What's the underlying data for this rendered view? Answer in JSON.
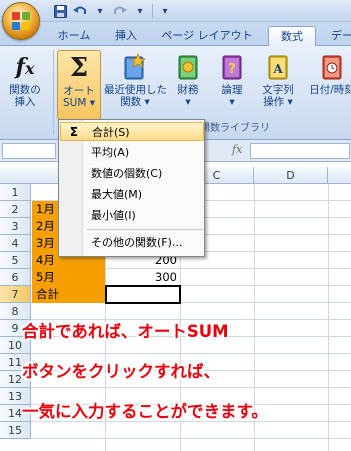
{
  "qat": {
    "save_icon": "save-icon",
    "undo_icon": "undo-icon",
    "redo_icon": "redo-icon",
    "customize_icon": "customize-icon"
  },
  "tabs": [
    {
      "label": "ホーム"
    },
    {
      "label": "挿入"
    },
    {
      "label": "ページ レイアウト"
    },
    {
      "label": "数式",
      "active": true
    },
    {
      "label": "デー"
    }
  ],
  "ribbon": {
    "buttons": [
      {
        "label1": "関数の",
        "label2": "挿入",
        "icon": "fx-icon"
      },
      {
        "label1": "オート",
        "label2": "SUM ▾",
        "icon": "sigma-icon",
        "pressed": true
      },
      {
        "label1": "最近使用した",
        "label2": "関数 ▾",
        "icon": "star-book-icon"
      },
      {
        "label1": "財務",
        "label2": "▾",
        "icon": "finance-book-icon"
      },
      {
        "label1": "論理",
        "label2": "▾",
        "icon": "logic-book-icon"
      },
      {
        "label1": "文字列",
        "label2": "操作 ▾",
        "icon": "text-book-icon"
      },
      {
        "label1": "日付/時刻",
        "label2": "",
        "icon": "date-book-icon"
      }
    ],
    "group_label": "関数ライブラリ"
  },
  "formula_bar": {
    "fx_label": "fx"
  },
  "menu": {
    "items": [
      {
        "icon": "Σ",
        "label": "合計(S)",
        "highlight": true
      },
      {
        "icon": "",
        "label": "平均(A)"
      },
      {
        "icon": "",
        "label": "数値の個数(C)"
      },
      {
        "icon": "",
        "label": "最大値(M)"
      },
      {
        "icon": "",
        "label": "最小値(I)"
      },
      {
        "icon": "",
        "label": "その他の関数(F)..."
      }
    ]
  },
  "sheet": {
    "columns": [
      "C",
      "D"
    ],
    "rows": [
      "1",
      "2",
      "3",
      "4",
      "5",
      "6",
      "7",
      "8",
      "9",
      "10",
      "11",
      "12",
      "13",
      "14",
      "15"
    ],
    "cells": {
      "a2": "1月",
      "a3": "2月",
      "a4": "3月",
      "a5": "4月",
      "a6": "5月",
      "a7": "合計",
      "b5": "200",
      "b6": "300"
    },
    "highlight_color": "#f5a000"
  },
  "annotation": {
    "line1": "合計であれば、オートSUM",
    "line2": "ボタンをクリックすれば、",
    "line3": "一気に入力することができます。",
    "color": "#e8000b"
  }
}
